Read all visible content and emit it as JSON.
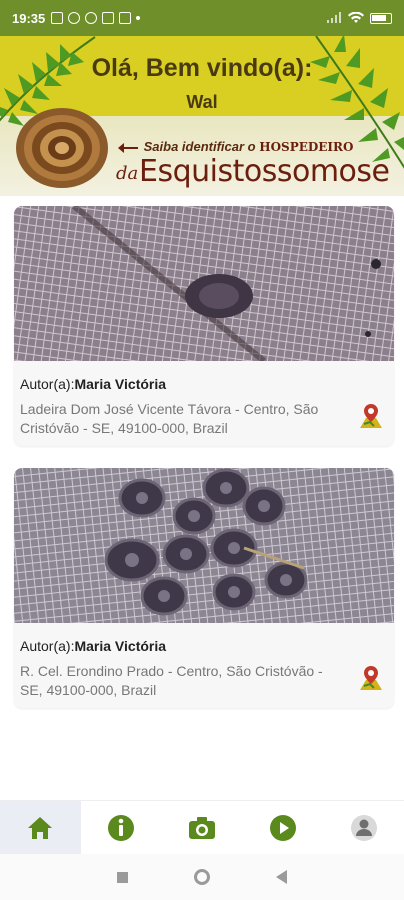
{
  "status_bar": {
    "time": "19:35"
  },
  "header": {
    "welcome": "Olá, Bem vindo(a):",
    "user_name": "Wal",
    "banner_line1_prefix": "Saiba identificar o",
    "banner_line1_emphasis": "HOSPEDEIRO",
    "banner_da": "da",
    "banner_big": "Esquistossomose"
  },
  "posts": [
    {
      "author_label": "Autor(a):",
      "author_name": "Maria Victória",
      "address": "Ladeira Dom José Vicente Távora - Centro, São Cristóvão - SE, 49100-000, Brazil",
      "photo_icon": "snail-on-mesh-photo",
      "pin_icon": "map-pin-icon"
    },
    {
      "author_label": "Autor(a):",
      "author_name": "Maria Victória",
      "address": "R. Cel. Erondino Prado - Centro, São Cristóvão - SE, 49100-000, Brazil",
      "photo_icon": "snails-cluster-photo",
      "pin_icon": "map-pin-icon"
    }
  ],
  "bottom_nav": {
    "items": [
      {
        "icon": "home-icon",
        "active": true
      },
      {
        "icon": "info-icon",
        "active": false
      },
      {
        "icon": "camera-icon",
        "active": false
      },
      {
        "icon": "play-icon",
        "active": false
      },
      {
        "icon": "profile-icon",
        "active": false
      }
    ]
  },
  "colors": {
    "status_bar": "#6f8f2a",
    "header_yellow": "#d8cf22",
    "nav_green": "#5a8a1e",
    "banner_brown": "#6b1e0e",
    "active_tab_bg": "#eaeef4"
  }
}
